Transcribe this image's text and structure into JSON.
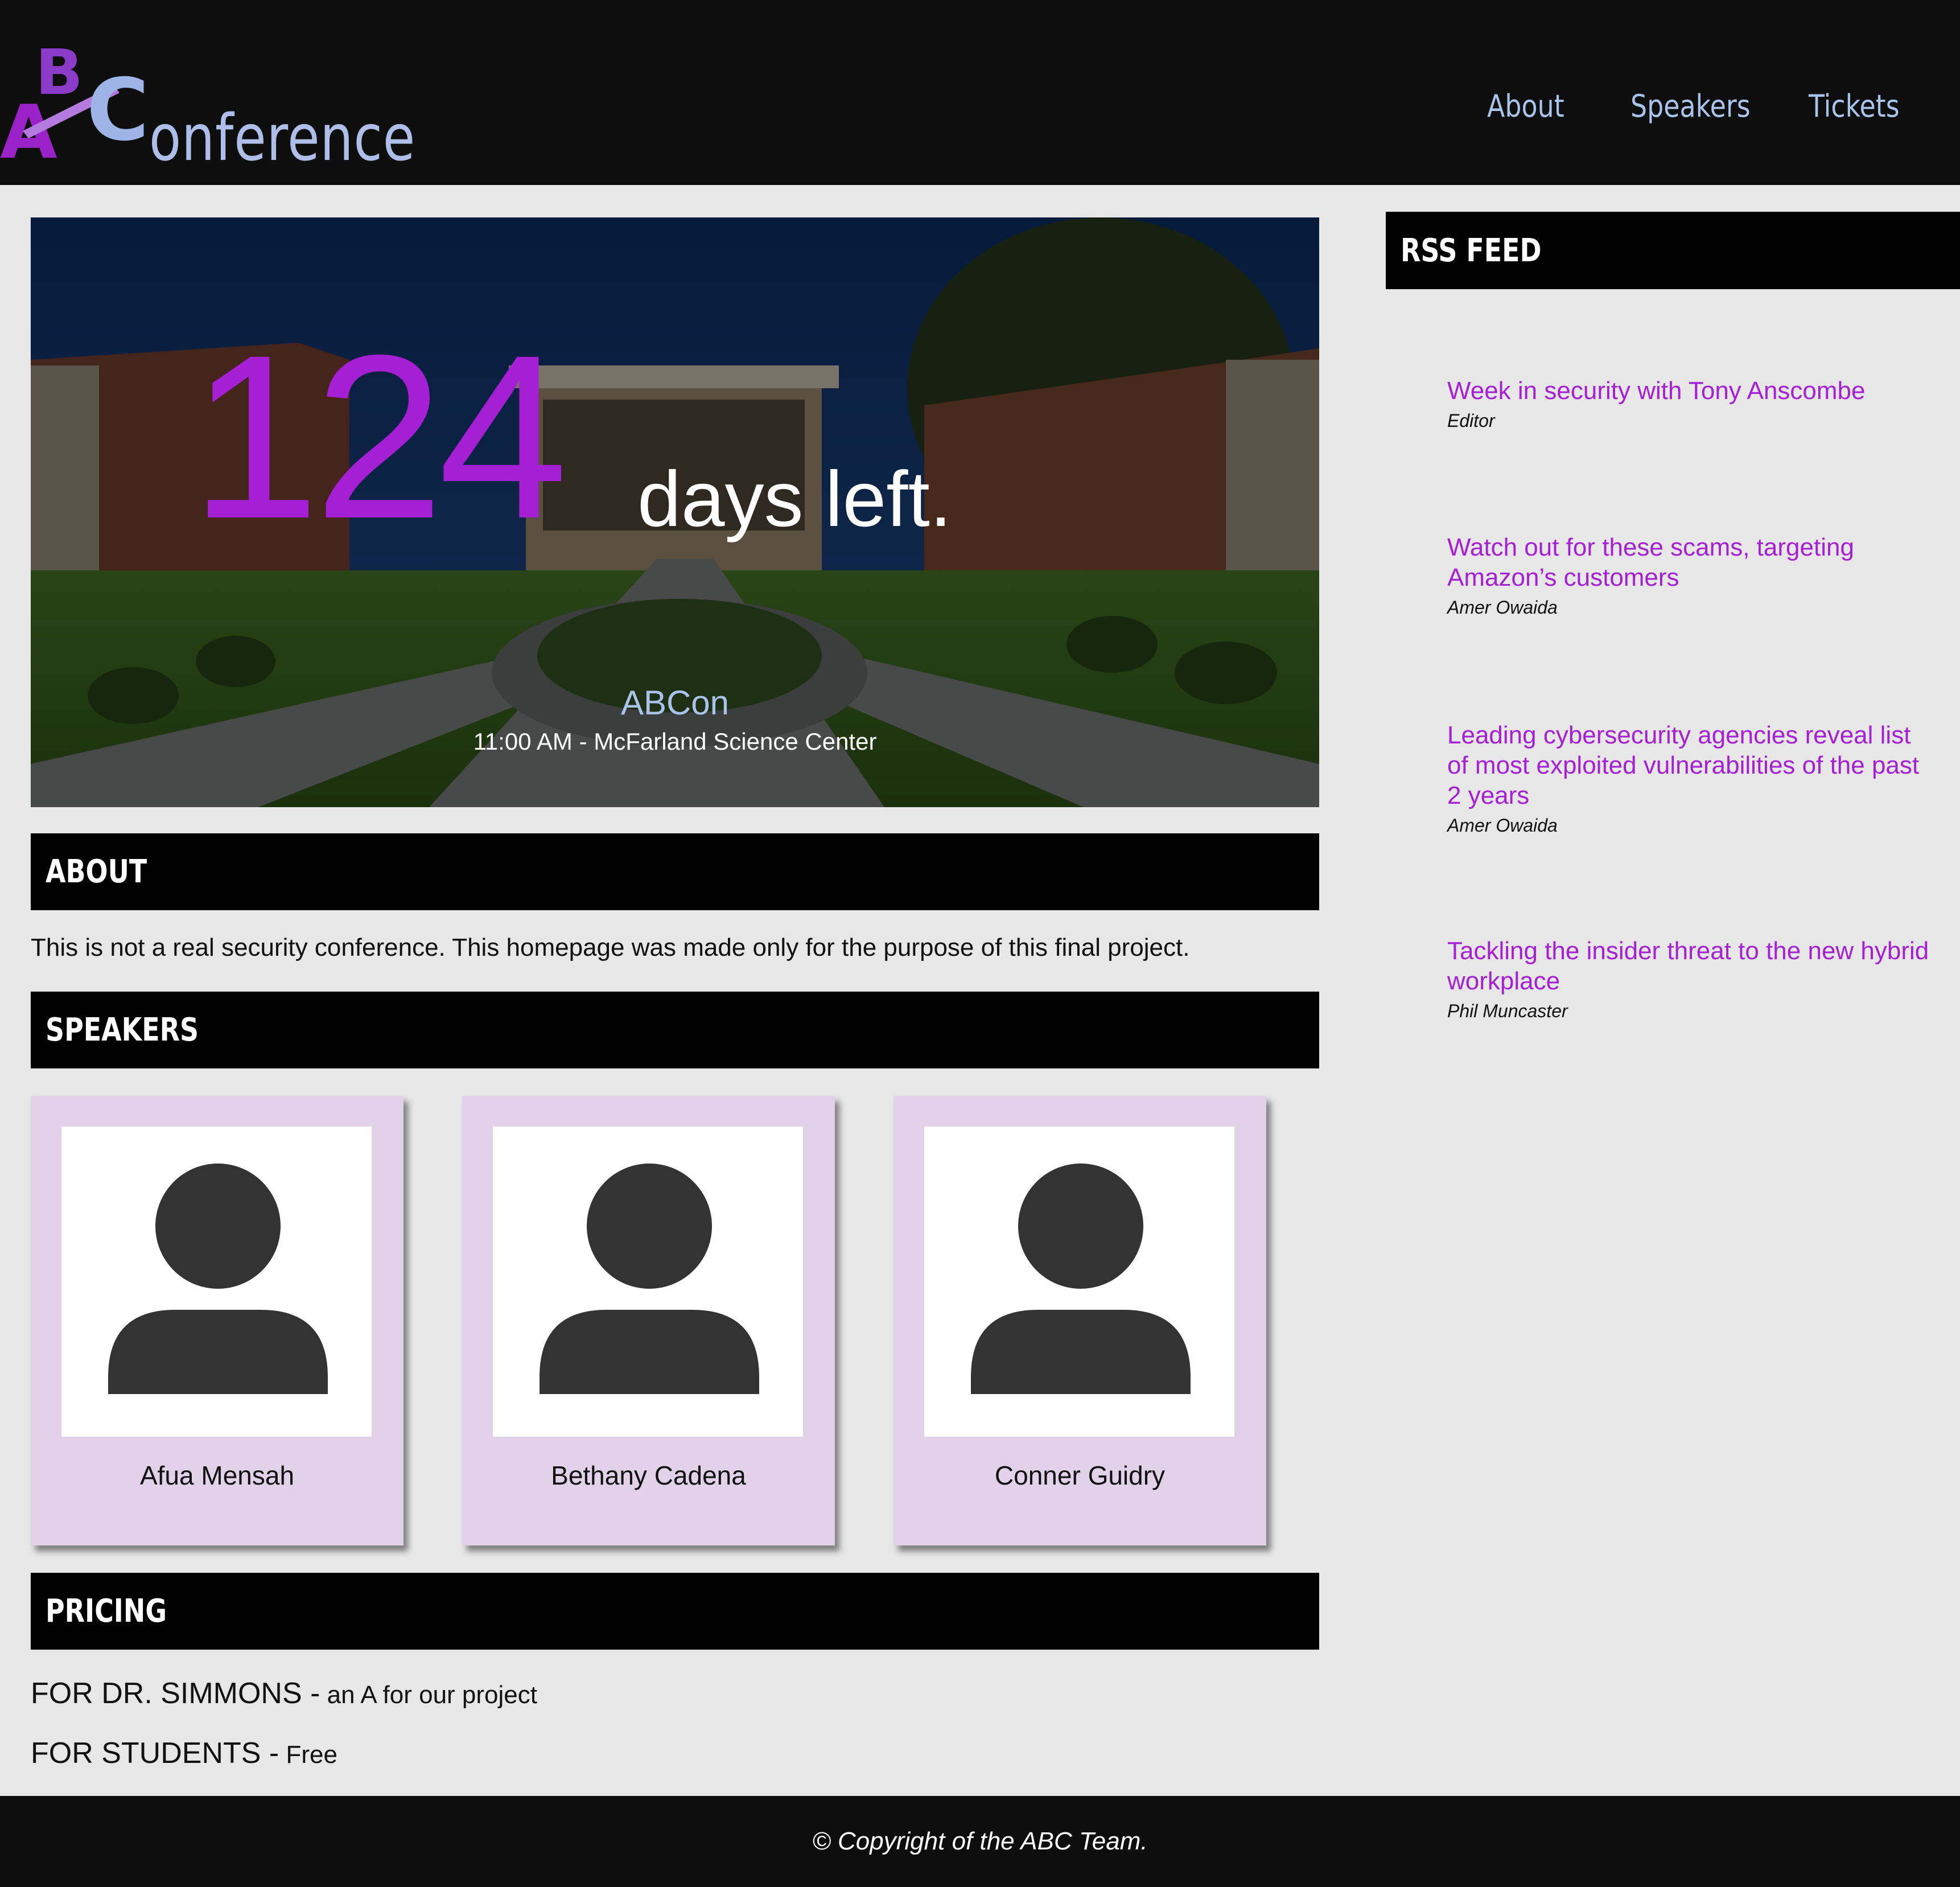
{
  "header": {
    "logo_letters": "ABC",
    "logo_word": "onference",
    "nav": [
      {
        "label": "About"
      },
      {
        "label": "Speakers"
      },
      {
        "label": "Tickets"
      }
    ]
  },
  "hero": {
    "days_left": "124",
    "days_label": "days left.",
    "event_name": "ABCon",
    "event_info": "11:00 AM - McFarland Science Center"
  },
  "about": {
    "heading": "ABOUT",
    "text": "This is not a real security conference. This homepage was made only for the purpose of this final project."
  },
  "speakers": {
    "heading": "SPEAKERS",
    "items": [
      {
        "name": "Afua Mensah",
        "icon": "person-icon"
      },
      {
        "name": "Bethany Cadena",
        "icon": "person-icon"
      },
      {
        "name": "Conner Guidry",
        "icon": "person-icon"
      }
    ]
  },
  "pricing": {
    "heading": "PRICING",
    "items": [
      {
        "label": "FOR DR. SIMMONS -",
        "value": "an A for our project"
      },
      {
        "label": "FOR STUDENTS -",
        "value": "Free"
      }
    ]
  },
  "rss": {
    "heading": "RSS FEED",
    "items": [
      {
        "title": "Week in security with Tony Anscombe",
        "author": "Editor"
      },
      {
        "title": "Watch out for these scams, targeting Amazon’s customers",
        "author": "Amer Owaida"
      },
      {
        "title": "Leading cybersecurity agencies reveal list of most exploited vulnerabilities of the past 2 years",
        "author": "Amer Owaida"
      },
      {
        "title": "Tackling the insider threat to the new hybrid workplace",
        "author": "Phil Muncaster"
      }
    ]
  },
  "footer": {
    "text": "© Copyright of the ABC Team."
  },
  "colors": {
    "accent_purple": "#a51fd4",
    "nav_blue": "#a9c3ea",
    "card_lavender": "#e1d2e9",
    "header_bg": "#0e0e0e",
    "page_bg": "#e7e7e7"
  }
}
